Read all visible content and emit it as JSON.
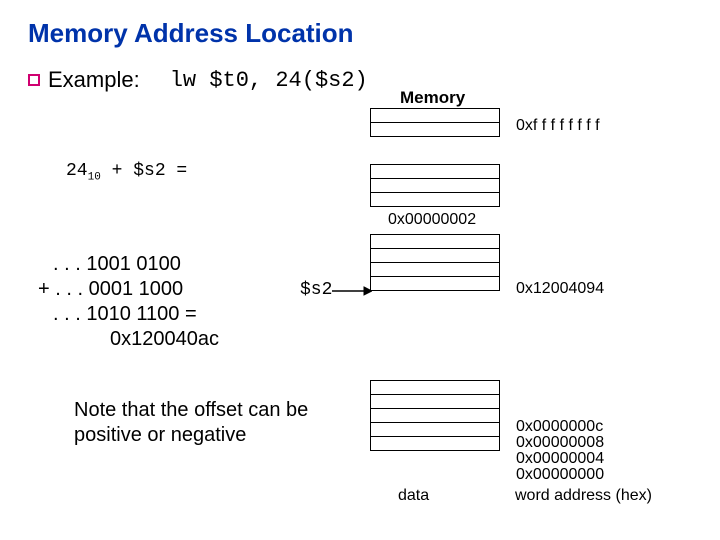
{
  "title": "Memory Address Location",
  "example_label": "Example:",
  "instruction": "lw $t0, 24($s2)",
  "memory_header": "Memory",
  "formula_lhs": "24",
  "formula_sub": "10",
  "formula_rhs": " + $s2 =",
  "binary": {
    "l1": ". . . 1001 0100",
    "l2": "+ . . . 0001 1000",
    "l3": ". . . 1010 1100 =",
    "l4": "0x120040ac"
  },
  "s2_pointer": "$s2",
  "addresses": {
    "top": "0xf f f f f f f f",
    "mid1": "0x00000002",
    "s2": "0x12004094",
    "b3": "0x0000000c",
    "b2": "0x00000008",
    "b1": "0x00000004",
    "b0": "0x00000000"
  },
  "data_col": "data",
  "addr_col": "word address (hex)",
  "note": "Note that the offset can be positive or negative"
}
